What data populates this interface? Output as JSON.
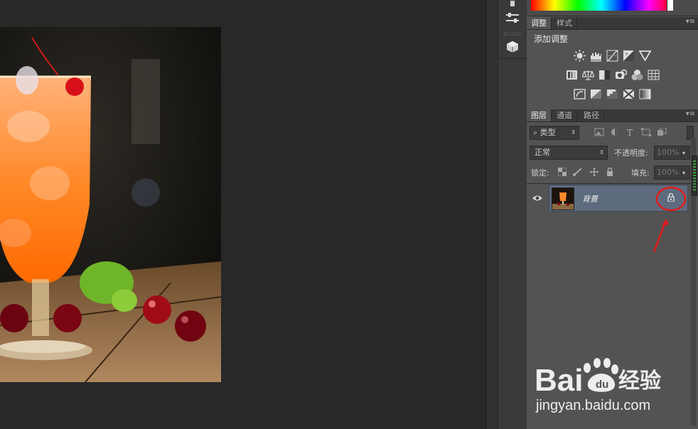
{
  "adjustments_panel": {
    "tabs": [
      "调整",
      "样式"
    ],
    "title": "添加调整",
    "icon_rows": [
      [
        "brightness-contrast-icon",
        "levels-icon",
        "curves-icon",
        "exposure-icon",
        "vibrance-icon"
      ],
      [
        "hue-saturation-icon",
        "color-balance-icon",
        "black-white-icon",
        "photo-filter-icon",
        "channel-mixer-icon",
        "color-lookup-icon"
      ],
      [
        "invert-icon",
        "posterize-icon",
        "threshold-icon",
        "selective-color-icon",
        "gradient-map-icon"
      ]
    ]
  },
  "layers_panel": {
    "tabs": [
      "图层",
      "通道",
      "路径"
    ],
    "filter_kind": "类型",
    "blend_mode": "正常",
    "opacity_label": "不透明度:",
    "opacity_value": "100%",
    "lock_label": "锁定:",
    "fill_label": "填充:",
    "fill_value": "100%",
    "layers": [
      {
        "name": "背景",
        "visible": true,
        "locked": true
      }
    ]
  },
  "annotation": {
    "color": "#e01c1c"
  },
  "watermark": {
    "url": "jingyan.baidu.com",
    "brand": "Bai",
    "suffix": "经验"
  }
}
